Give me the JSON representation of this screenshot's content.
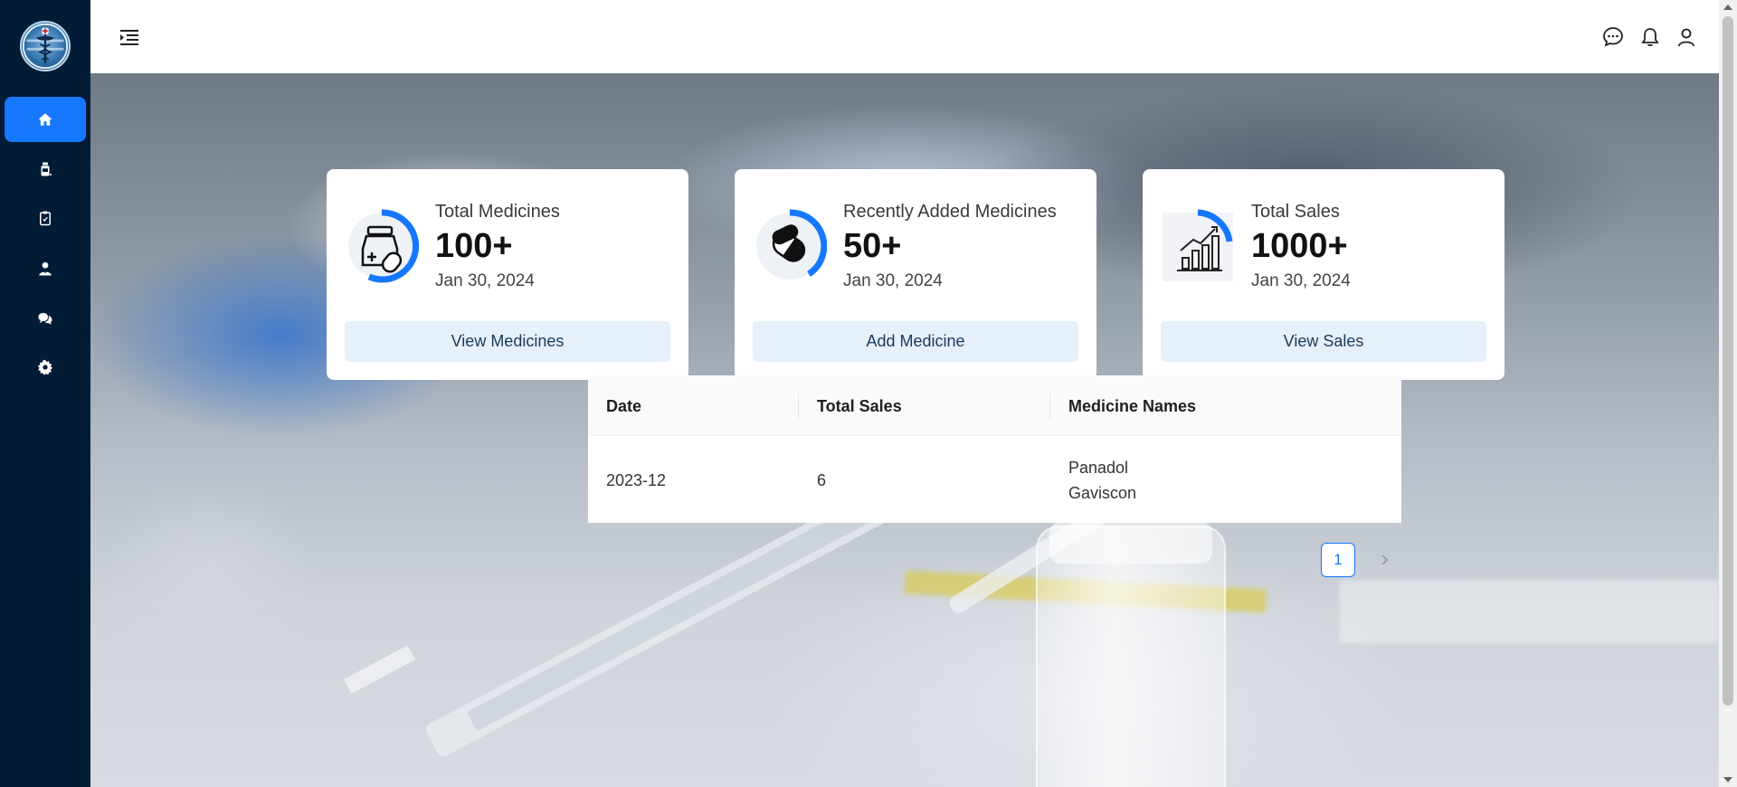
{
  "header": {
    "icons": [
      "menu-unfold-icon",
      "message-icon",
      "bell-icon",
      "user-icon"
    ]
  },
  "sidebar": {
    "items": [
      {
        "icon": "home-icon",
        "active": true
      },
      {
        "icon": "medicine-bottle-icon",
        "active": false
      },
      {
        "icon": "clipboard-icon",
        "active": false
      },
      {
        "icon": "doctor-icon",
        "active": false
      },
      {
        "icon": "chat-bubbles-icon",
        "active": false
      },
      {
        "icon": "gear-icon",
        "active": false
      }
    ]
  },
  "cards": [
    {
      "icon": "medicine-jar-icon",
      "title": "Total Medicines",
      "value": "100+",
      "date": "Jan 30, 2024",
      "button": "View Medicines"
    },
    {
      "icon": "capsule-icon",
      "title": "Recently Added Medicines",
      "value": "50+",
      "date": "Jan 30, 2024",
      "button": "Add Medicine"
    },
    {
      "icon": "sales-chart-icon",
      "title": "Total Sales",
      "value": "1000+",
      "date": "Jan 30, 2024",
      "button": "View Sales"
    }
  ],
  "table": {
    "columns": [
      "Date",
      "Total Sales",
      "Medicine Names"
    ],
    "rows": [
      {
        "date": "2023-12",
        "total_sales": "6",
        "medicine_names": [
          "Panadol",
          "Gaviscon"
        ]
      }
    ]
  },
  "pagination": {
    "current_page": "1"
  },
  "colors": {
    "sidebar": "#021c36",
    "accent": "#1677ff",
    "card_button_bg": "#e6f0fa"
  }
}
